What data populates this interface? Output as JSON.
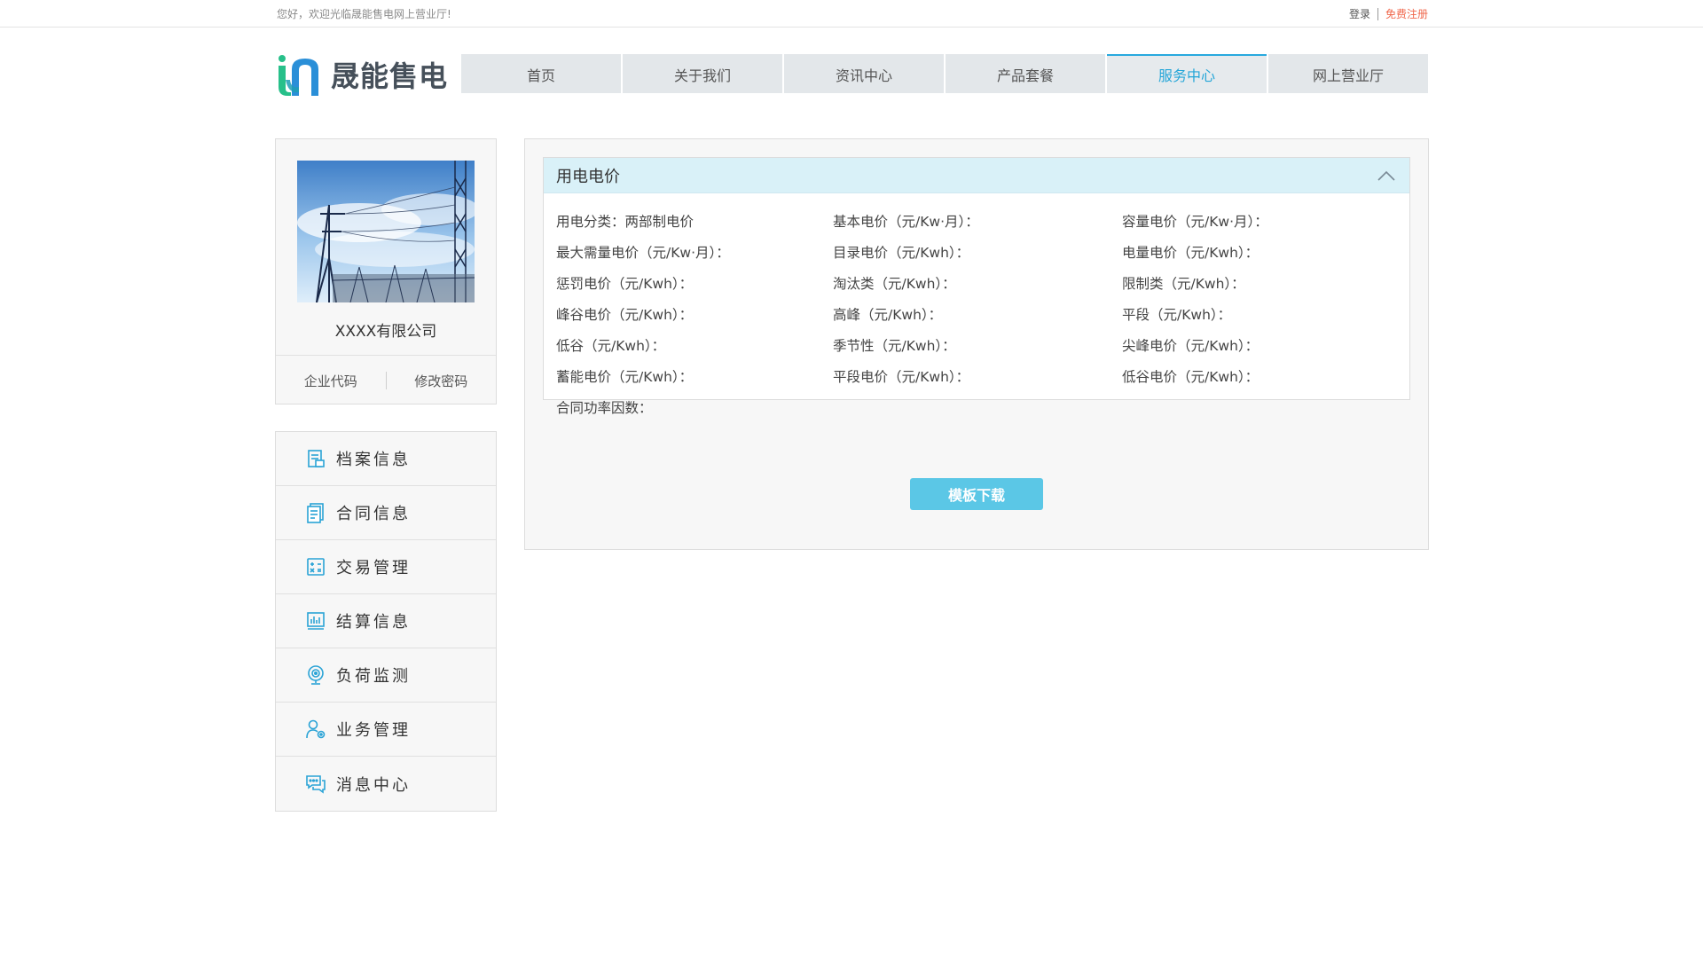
{
  "topbar": {
    "welcome": "您好，欢迎光临晟能售电网上营业厅!",
    "login": "登录",
    "register": "免费注册"
  },
  "brand": {
    "name": "晟能售电",
    "colors": {
      "logo_blue": "#2a8fd8",
      "logo_green": "#27c08a",
      "accent": "#28a9de",
      "register": "#f0674b"
    }
  },
  "nav": {
    "items": [
      {
        "label": "首页"
      },
      {
        "label": "关于我们"
      },
      {
        "label": "资讯中心"
      },
      {
        "label": "产品套餐"
      },
      {
        "label": "服务中心",
        "active": true
      },
      {
        "label": "网上营业厅"
      }
    ]
  },
  "profile": {
    "company": "XXXX有限公司",
    "links": {
      "code": "企业代码",
      "password": "修改密码"
    }
  },
  "menu": {
    "items": [
      {
        "label": "档案信息",
        "icon": "archive-icon"
      },
      {
        "label": "合同信息",
        "icon": "contract-icon"
      },
      {
        "label": "交易管理",
        "icon": "calculator-icon"
      },
      {
        "label": "结算信息",
        "icon": "chart-icon"
      },
      {
        "label": "负荷监测",
        "icon": "monitor-icon"
      },
      {
        "label": "业务管理",
        "icon": "user-gear-icon"
      },
      {
        "label": "消息中心",
        "icon": "message-icon"
      }
    ]
  },
  "price": {
    "title": "用电电价",
    "rows": [
      [
        "用电分类：两部制电价",
        "基本电价（元/Kw·月）：",
        "容量电价（元/Kw·月）："
      ],
      [
        "最大需量电价（元/Kw·月）：",
        "目录电价（元/Kwh）：",
        "电量电价（元/Kwh）："
      ],
      [
        "惩罚电价（元/Kwh）：",
        "淘汰类（元/Kwh）：",
        "限制类（元/Kwh）："
      ],
      [
        "峰谷电价（元/Kwh）：",
        "高峰（元/Kwh）：",
        "平段（元/Kwh）："
      ],
      [
        "低谷（元/Kwh）：",
        "季节性（元/Kwh）：",
        "尖峰电价（元/Kwh）："
      ],
      [
        "蓄能电价（元/Kwh）：",
        "平段电价（元/Kwh）：",
        "低谷电价（元/Kwh）："
      ],
      [
        "合同功率因数：",
        "",
        ""
      ]
    ]
  },
  "actions": {
    "download": "模板下载"
  }
}
